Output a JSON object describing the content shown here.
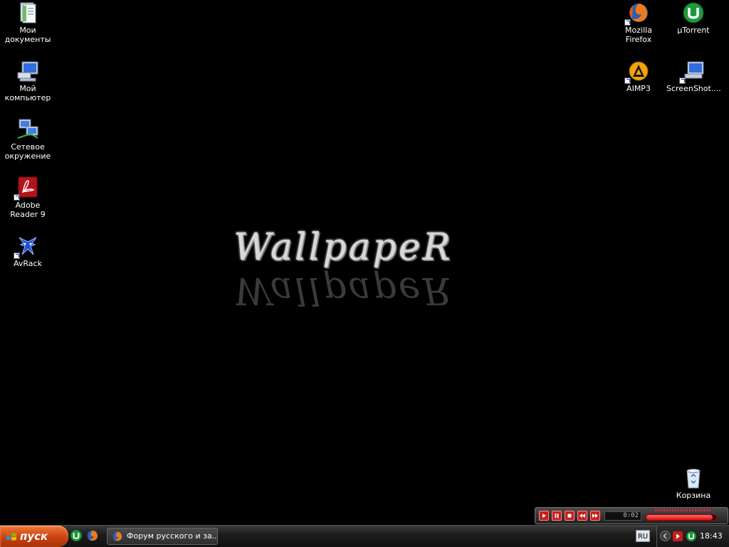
{
  "desktop": {
    "wallpaper_text": "WallpapeR",
    "left_icons": [
      {
        "label": "Мои документы",
        "icon": "my-documents-icon"
      },
      {
        "label": "Мой компьютер",
        "icon": "my-computer-icon"
      },
      {
        "label": "Сетевое окружение",
        "icon": "network-places-icon"
      },
      {
        "label": "Adobe Reader 9",
        "icon": "adobe-reader-icon"
      },
      {
        "label": "AvRack",
        "icon": "avrack-icon"
      }
    ],
    "right_icons": [
      {
        "label": "Mozilla Firefox",
        "icon": "firefox-icon"
      },
      {
        "label": "µTorrent",
        "icon": "utorrent-icon"
      },
      {
        "label": "AIMP3",
        "icon": "aimp-icon"
      },
      {
        "label": "ScreenShot....",
        "icon": "screenshot-icon"
      }
    ],
    "recycle_bin": {
      "label": "Корзина",
      "icon": "recycle-bin-icon"
    }
  },
  "player": {
    "time": "0:02",
    "progress": 0.95,
    "accent": "#c81e1e"
  },
  "taskbar": {
    "start_label": "пуск",
    "start_color": "#c9420f",
    "quick_launch": [
      "utorrent-icon",
      "firefox-icon"
    ],
    "task_label": "Форум русского и за...",
    "language": "RU",
    "clock": "18:43"
  }
}
